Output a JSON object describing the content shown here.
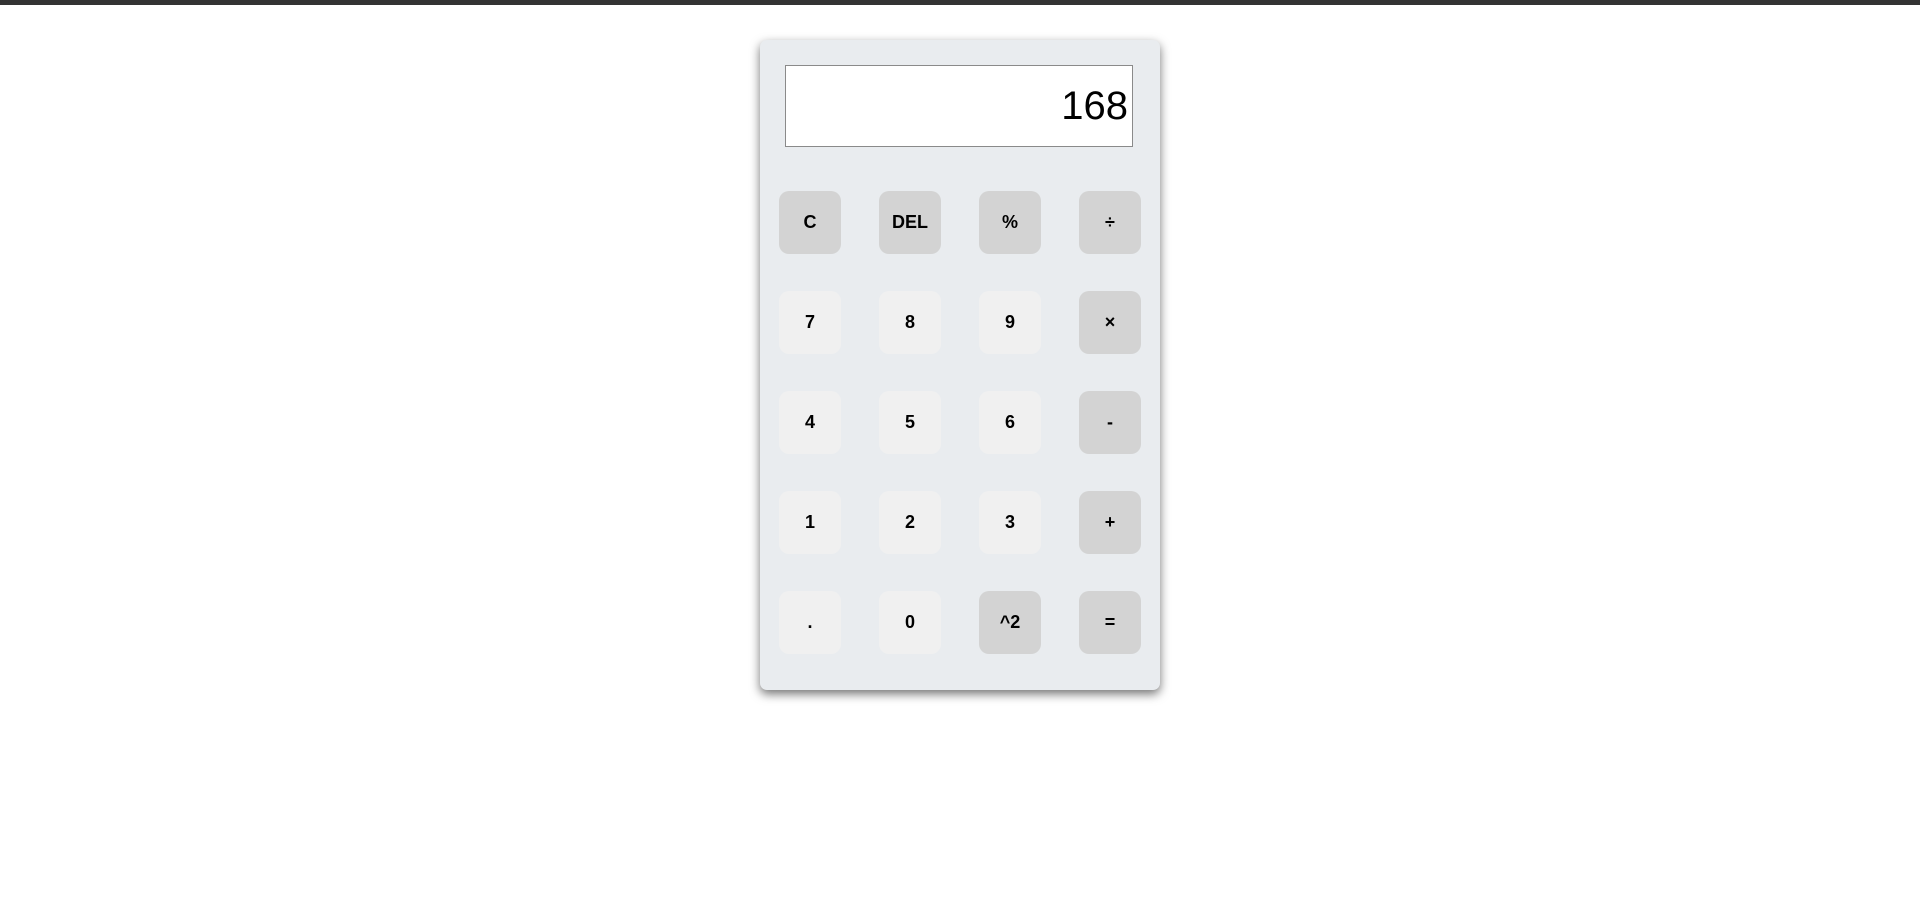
{
  "display": {
    "value": "168"
  },
  "keys": [
    {
      "label": "C",
      "kind": "op",
      "name": "clear-button"
    },
    {
      "label": "DEL",
      "kind": "op",
      "name": "delete-button"
    },
    {
      "label": "%",
      "kind": "op",
      "name": "percent-button"
    },
    {
      "label": "÷",
      "kind": "op",
      "name": "divide-button"
    },
    {
      "label": "7",
      "kind": "num",
      "name": "digit-7-button"
    },
    {
      "label": "8",
      "kind": "num",
      "name": "digit-8-button"
    },
    {
      "label": "9",
      "kind": "num",
      "name": "digit-9-button"
    },
    {
      "label": "×",
      "kind": "op",
      "name": "multiply-button"
    },
    {
      "label": "4",
      "kind": "num",
      "name": "digit-4-button"
    },
    {
      "label": "5",
      "kind": "num",
      "name": "digit-5-button"
    },
    {
      "label": "6",
      "kind": "num",
      "name": "digit-6-button"
    },
    {
      "label": "-",
      "kind": "op",
      "name": "subtract-button"
    },
    {
      "label": "1",
      "kind": "num",
      "name": "digit-1-button"
    },
    {
      "label": "2",
      "kind": "num",
      "name": "digit-2-button"
    },
    {
      "label": "3",
      "kind": "num",
      "name": "digit-3-button"
    },
    {
      "label": "+",
      "kind": "op",
      "name": "add-button"
    },
    {
      "label": ".",
      "kind": "num",
      "name": "decimal-point-button"
    },
    {
      "label": "0",
      "kind": "num",
      "name": "digit-0-button"
    },
    {
      "label": "^2",
      "kind": "op",
      "name": "square-button"
    },
    {
      "label": "=",
      "kind": "op",
      "name": "equals-button"
    }
  ],
  "colors": {
    "top_bar": "#333333",
    "calculator_body": "#e9ecef",
    "number_key": "#f0f0f0",
    "operator_key": "#d3d3d3"
  }
}
